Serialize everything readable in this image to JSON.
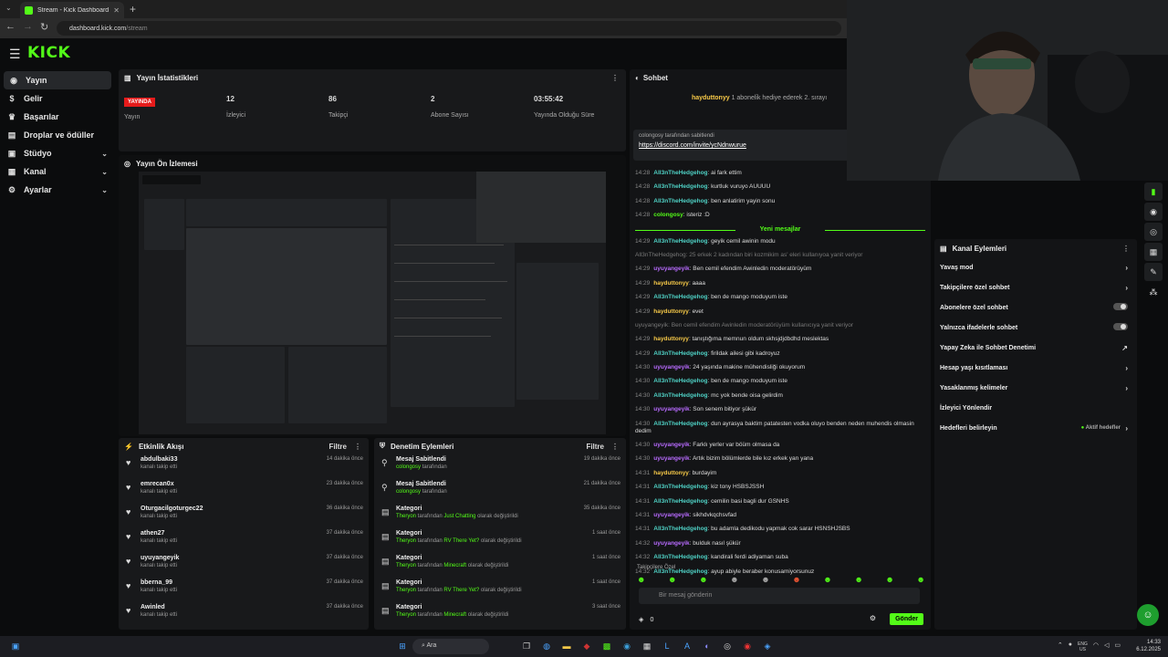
{
  "browser": {
    "tab_title": "Stream - Kick Dashboard",
    "url_host": "dashboard.kick.com",
    "url_path": "/stream"
  },
  "brand": {
    "logo": "KICK",
    "accent": "#53fc18"
  },
  "sidebar": {
    "items": [
      {
        "label": "Yayın",
        "icon": "broadcast-icon"
      },
      {
        "label": "Gelir",
        "icon": "money-icon"
      },
      {
        "label": "Başarılar",
        "icon": "trophy-icon"
      },
      {
        "label": "Droplar ve ödüller",
        "icon": "gift-icon"
      },
      {
        "label": "Stüdyo",
        "icon": "video-icon"
      },
      {
        "label": "Kanal",
        "icon": "channel-icon"
      },
      {
        "label": "Ayarlar",
        "icon": "gear-icon"
      }
    ]
  },
  "stats": {
    "title": "Yayın İstatistikleri",
    "live_badge": "YAYINDA",
    "live_label": "Yayın",
    "viewers": "12",
    "viewers_label": "İzleyici",
    "followers": "86",
    "followers_label": "Takipçi",
    "subs": "2",
    "subs_label": "Abone Sayısı",
    "uptime": "03:55:42",
    "uptime_label": "Yayında Olduğu Süre"
  },
  "preview": {
    "title": "Yayın Ön İzlemesi"
  },
  "activity": {
    "title": "Etkinlik Akışı",
    "filter": "Filtre",
    "items": [
      {
        "name": "abdulbaki33",
        "sub": "kanalı takip etti",
        "time": "14 dakika önce"
      },
      {
        "name": "emrecan0x",
        "sub": "kanalı takip etti",
        "time": "23 dakika önce"
      },
      {
        "name": "Oturgacilgoturgec22",
        "sub": "kanalı takip etti",
        "time": "36 dakika önce"
      },
      {
        "name": "athen27",
        "sub": "kanalı takip etti",
        "time": "37 dakika önce"
      },
      {
        "name": "uyuyangeyik",
        "sub": "kanalı takip etti",
        "time": "37 dakika önce"
      },
      {
        "name": "bberna_99",
        "sub": "kanalı takip etti",
        "time": "37 dakika önce"
      },
      {
        "name": "Awinled",
        "sub": "kanalı takip etti",
        "time": "37 dakika önce"
      }
    ]
  },
  "modlog": {
    "title": "Denetim Eylemleri",
    "filter": "Filtre",
    "items": [
      {
        "icon": "pin-icon",
        "title": "Mesaj Sabitlendi",
        "who": "colongosy",
        "rest": " tarafından",
        "hl": "",
        "tail": "",
        "time": "19 dakika önce"
      },
      {
        "icon": "pin-icon",
        "title": "Mesaj Sabitlendi",
        "who": "colongosy",
        "rest": " tarafından",
        "hl": "",
        "tail": "",
        "time": "21 dakika önce"
      },
      {
        "icon": "category-icon",
        "title": "Kategori",
        "who": "Theryon",
        "rest": " tarafından ",
        "hl": "Just Chatting",
        "tail": " olarak değiştirildi",
        "time": "35 dakika önce"
      },
      {
        "icon": "category-icon",
        "title": "Kategori",
        "who": "Theryon",
        "rest": " tarafından ",
        "hl": "RV There Yet?",
        "tail": " olarak değiştirildi",
        "time": "1 saat önce"
      },
      {
        "icon": "category-icon",
        "title": "Kategori",
        "who": "Theryon",
        "rest": " tarafından ",
        "hl": "Minecraft",
        "tail": " olarak değiştirildi",
        "time": "1 saat önce"
      },
      {
        "icon": "category-icon",
        "title": "Kategori",
        "who": "Theryon",
        "rest": " tarafından ",
        "hl": "RV There Yet?",
        "tail": " olarak değiştirildi",
        "time": "1 saat önce"
      },
      {
        "icon": "category-icon",
        "title": "Kategori",
        "who": "Theryon",
        "rest": " tarafından ",
        "hl": "Minecraft",
        "tail": " olarak değiştirildi",
        "time": "3 saat önce"
      }
    ]
  },
  "chat": {
    "title": "Sohbet",
    "gift_user": "hayduttonyy",
    "gift_text": "1 aboneli̇k hediye ederek 2. sırayı",
    "pinned_by": "colongosy tarafından sabitlendi",
    "pinned_link": "https://discord.com/invite/ycNdnwurue",
    "new_messages": "Yeni mesajlar",
    "followers_only": "Takipçilere Özel",
    "input_placeholder": "Bir mesaj gönderin",
    "coins": "0",
    "send": "Gönder",
    "messages_before": [
      {
        "time": "14:28",
        "user": "All3nTheHedgehog",
        "color": "u-c",
        "text": "ai fark ettim"
      },
      {
        "time": "14:28",
        "user": "All3nTheHedgehog",
        "color": "u-c",
        "text": "kurtluk vuruyo AUUUU"
      },
      {
        "time": "14:28",
        "user": "All3nTheHedgehog",
        "color": "u-c",
        "text": "ben anlatirim yayin sonu"
      },
      {
        "time": "14:28",
        "user": "colongosy",
        "color": "u-g",
        "text": "isteriz :D"
      }
    ],
    "messages_after": [
      {
        "time": "14:29",
        "user": "All3nTheHedgehog",
        "color": "u-c",
        "text": "geyik cemil awinin modu"
      },
      {
        "time": "",
        "user": "",
        "color": "",
        "text": "All3nTheHedgehog: 25 erkek 2 kadından biri kozmikim as' eleri kullanıyoa yanit veriyor",
        "sys": true
      },
      {
        "time": "14:29",
        "user": "uyuyangeyik",
        "color": "u-p",
        "text": "Ben cemil efendim Awinledin moderatörüyüm"
      },
      {
        "time": "14:29",
        "user": "hayduttonyy",
        "color": "u-y",
        "text": "aaaa"
      },
      {
        "time": "14:29",
        "user": "All3nTheHedgehog",
        "color": "u-c",
        "text": "ben de mango moduyum iste"
      },
      {
        "time": "14:29",
        "user": "hayduttonyy",
        "color": "u-y",
        "text": "evet"
      },
      {
        "time": "",
        "user": "",
        "color": "",
        "text": "uyuyangeyik: Ben cemil efendim Awinledin moderatörüyüm kullanıcıya yanit veriyor",
        "sys": true
      },
      {
        "time": "14:29",
        "user": "hayduttonyy",
        "color": "u-y",
        "text": "tanıştığıma memnun oldum skhsjdjdbdhd meslektas"
      },
      {
        "time": "14:29",
        "user": "All3nTheHedgehog",
        "color": "u-c",
        "text": "firildak ailesi gibi kadroyuz"
      },
      {
        "time": "14:30",
        "user": "uyuyangeyik",
        "color": "u-p",
        "text": "24 yaşında makine mühendisliği okuyorum"
      },
      {
        "time": "14:30",
        "user": "All3nTheHedgehog",
        "color": "u-c",
        "text": "ben de mango moduyum iste"
      },
      {
        "time": "14:30",
        "user": "All3nTheHedgehog",
        "color": "u-c",
        "text": "mc yok bende oisa gelirdim"
      },
      {
        "time": "14:30",
        "user": "uyuyangeyik",
        "color": "u-p",
        "text": "Son senem bitiyor şükür"
      },
      {
        "time": "14:30",
        "user": "All3nTheHedgehog",
        "color": "u-c",
        "text": "dun ayrasya baktim patatesten vodka oluyo benden neden muhendis olmasin dedim"
      },
      {
        "time": "14:30",
        "user": "uyuyangeyik",
        "color": "u-p",
        "text": "Farklı yerler var böüm olmasa da"
      },
      {
        "time": "14:30",
        "user": "uyuyangeyik",
        "color": "u-p",
        "text": "Artık bizim bölümlerde bile kız erkek yan yana"
      },
      {
        "time": "14:31",
        "user": "hayduttonyy",
        "color": "u-y",
        "text": "burdayim"
      },
      {
        "time": "14:31",
        "user": "All3nTheHedgehog",
        "color": "u-c",
        "text": "kiz tony HSBSJSSH"
      },
      {
        "time": "14:31",
        "user": "All3nTheHedgehog",
        "color": "u-c",
        "text": "cemilin basi bagli dur GSNHS"
      },
      {
        "time": "14:31",
        "user": "uyuyangeyik",
        "color": "u-p",
        "text": "sikhdvkqchsvfad"
      },
      {
        "time": "14:31",
        "user": "All3nTheHedgehog",
        "color": "u-c",
        "text": "bu adamla dedikodu yapmak cok sarar HSNSHJSBS"
      },
      {
        "time": "14:32",
        "user": "uyuyangeyik",
        "color": "u-p",
        "text": "bulduk nasıl şükür"
      },
      {
        "time": "14:32",
        "user": "All3nTheHedgehog",
        "color": "u-c",
        "text": "kandirali ferdi adiyaman suba"
      },
      {
        "time": "14:32",
        "user": "All3nTheHedgehog",
        "color": "u-c",
        "text": "ayup abiyle beraber konusamiyorsunuz"
      }
    ]
  },
  "channel_actions": {
    "title": "Kanal Eylemleri",
    "rows": [
      {
        "label": "Yavaş mod",
        "kind": "chev"
      },
      {
        "label": "Takipçilere özel sohbet",
        "kind": "chev"
      },
      {
        "label": "Abonelere özel sohbet",
        "kind": "toggle"
      },
      {
        "label": "Yalnızca ifadelerle sohbet",
        "kind": "toggle"
      },
      {
        "label": "Yapay Zeka ile Sohbet Denetimi",
        "kind": "ext"
      },
      {
        "label": "Hesap yaşı kısıtlaması",
        "kind": "chev"
      },
      {
        "label": "Yasaklanmış kelimeler",
        "kind": "chev"
      },
      {
        "label": "İzleyici Yönlendir",
        "kind": "none"
      },
      {
        "label": "Hedefleri belirleyin",
        "kind": "goal"
      }
    ],
    "goal_status": "Aktif hedefler"
  },
  "taskbar": {
    "search": "Ara",
    "lang": "ENG",
    "region": "US",
    "time": "14:33",
    "date": "6.12.2025"
  }
}
